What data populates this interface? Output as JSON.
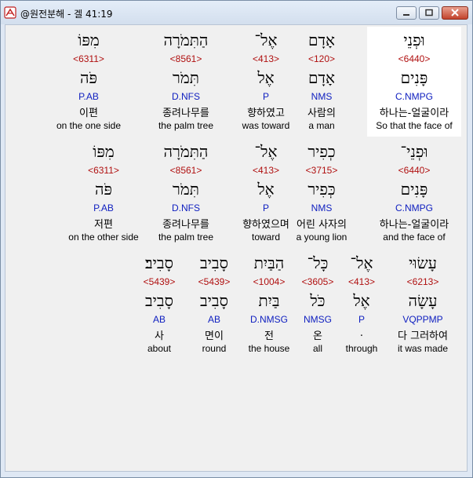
{
  "window": {
    "title": "@원전분해 - 겔 41:19"
  },
  "colors": {
    "strong": "#b01010",
    "parse": "#1020c0",
    "highlight": "#ffffff"
  },
  "rows": [
    {
      "words": [
        {
          "hebrew": "וּפְנֵי",
          "strong": "<6440>",
          "lemma": "פָּנִים",
          "parse": "C.NMPG",
          "korean": "하나는-얼굴이라",
          "english": "So that the face of",
          "highlight": true
        },
        {
          "hebrew": "אָדָם",
          "strong": "<120>",
          "lemma": "אָדָם",
          "parse": "NMS",
          "korean": "사람의",
          "english": "a man"
        },
        {
          "hebrew": "אֶל־",
          "strong": "<413>",
          "lemma": "אֶל",
          "parse": "P",
          "korean": "향하였고",
          "english": "was toward"
        },
        {
          "hebrew": "הַתִּמֹרָה",
          "strong": "<8561>",
          "lemma": "תִּמֹר",
          "parse": "D.NFS",
          "korean": "종려나무를",
          "english": "the palm tree"
        },
        {
          "hebrew": "מִפּוֹ",
          "strong": "<6311>",
          "lemma": "פֹּה",
          "parse": "P.AB",
          "korean": "이편",
          "english": "on the one side"
        }
      ]
    },
    {
      "words": [
        {
          "hebrew": "וּפְנֵי־",
          "strong": "<6440>",
          "lemma": "פָּנִים",
          "parse": "C.NMPG",
          "korean": "하나는-얼굴이라",
          "english": "and the face of"
        },
        {
          "hebrew": "כְפִיר",
          "strong": "<3715>",
          "lemma": "כְּפִיר",
          "parse": "NMS",
          "korean": "어린 사자의",
          "english": "a young lion"
        },
        {
          "hebrew": "אֶל־",
          "strong": "<413>",
          "lemma": "אֶל",
          "parse": "P",
          "korean": "향하였으며",
          "english": "toward"
        },
        {
          "hebrew": "הַתִּמֹרָה",
          "strong": "<8561>",
          "lemma": "תִּמֹר",
          "parse": "D.NFS",
          "korean": "종려나무를",
          "english": "the palm tree"
        },
        {
          "hebrew": "מִפּוֹ",
          "strong": "<6311>",
          "lemma": "פֹּה",
          "parse": "P.AB",
          "korean": "저편",
          "english": "on the other side"
        }
      ]
    },
    {
      "words": [
        {
          "hebrew": "עָשׂוּי",
          "strong": "<6213>",
          "lemma": "עָשָׂה",
          "parse": "VQPPMP",
          "korean": "다 그러하여",
          "english": "it was made"
        },
        {
          "hebrew": "אֶל־",
          "strong": "<413>",
          "lemma": "אֶל",
          "parse": "P",
          "korean": ".",
          "english": "through"
        },
        {
          "hebrew": "כָּל־",
          "strong": "<3605>",
          "lemma": "כֹּל",
          "parse": "NMSG",
          "korean": "온",
          "english": "all"
        },
        {
          "hebrew": "הַבַּיִת",
          "strong": "<1004>",
          "lemma": "בַּיִת",
          "parse": "D.NMSG",
          "korean": "전",
          "english": "the house"
        },
        {
          "hebrew": "סָבִיב",
          "strong": "<5439>",
          "lemma": "סָבִיב",
          "parse": "AB",
          "korean": "면이",
          "english": "round"
        },
        {
          "hebrew": "סָבִיב׃",
          "strong": "<5439>",
          "lemma": "סָבִיב",
          "parse": "AB",
          "korean": "사",
          "english": "about"
        }
      ]
    }
  ]
}
